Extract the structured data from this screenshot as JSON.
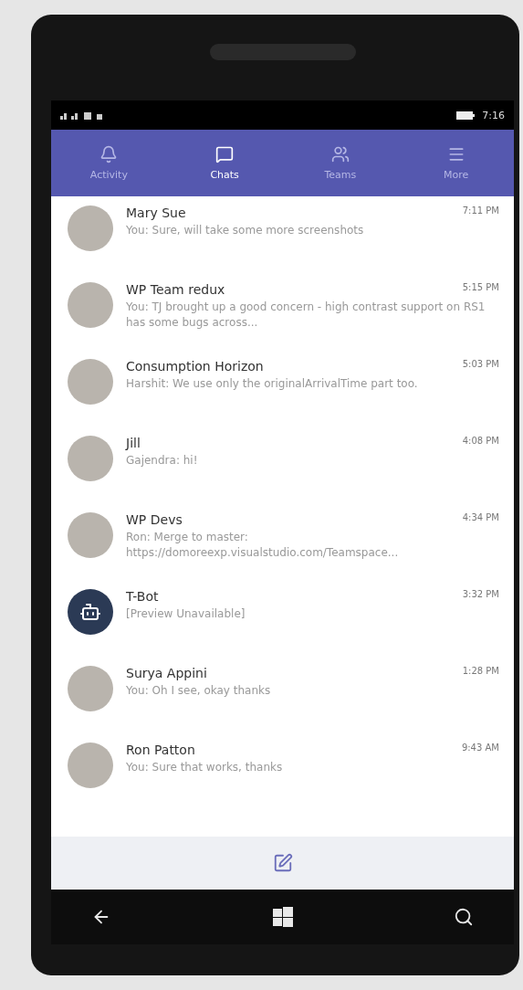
{
  "status_bar": {
    "time": "7:16"
  },
  "tabs": [
    {
      "label": "Activity",
      "kind": "bell",
      "selected": false
    },
    {
      "label": "Chats",
      "kind": "chat",
      "selected": true
    },
    {
      "label": "Teams",
      "kind": "teams",
      "selected": false
    },
    {
      "label": "More",
      "kind": "menu",
      "selected": false
    }
  ],
  "chats": [
    {
      "name": "Mary Sue",
      "time": "7:11 PM",
      "preview": "You: Sure, will take some more screenshots",
      "kind": "photo"
    },
    {
      "name": "WP Team redux",
      "time": "5:15 PM",
      "preview": "You: TJ brought up a good concern - high contrast support on RS1 has some bugs across...",
      "kind": "photo"
    },
    {
      "name": "Consumption Horizon",
      "time": "5:03 PM",
      "preview": "Harshit: We use only the originalArrivalTime part too.",
      "kind": "photo"
    },
    {
      "name": "Jill",
      "time": "4:08 PM",
      "preview": "Gajendra: hi!",
      "kind": "photo"
    },
    {
      "name": "WP Devs",
      "time": "4:34 PM",
      "preview": "Ron: Merge to master: https://domoreexp.visualstudio.com/Teamspace...",
      "kind": "photo"
    },
    {
      "name": "T-Bot",
      "time": "3:32 PM",
      "preview": "[Preview Unavailable]",
      "kind": "bot"
    },
    {
      "name": "Surya Appini",
      "time": "1:28 PM",
      "preview": "You: Oh I see, okay thanks",
      "kind": "photo"
    },
    {
      "name": "Ron Patton",
      "time": "9:43 AM",
      "preview": "You: Sure that works, thanks",
      "kind": "photo"
    }
  ]
}
